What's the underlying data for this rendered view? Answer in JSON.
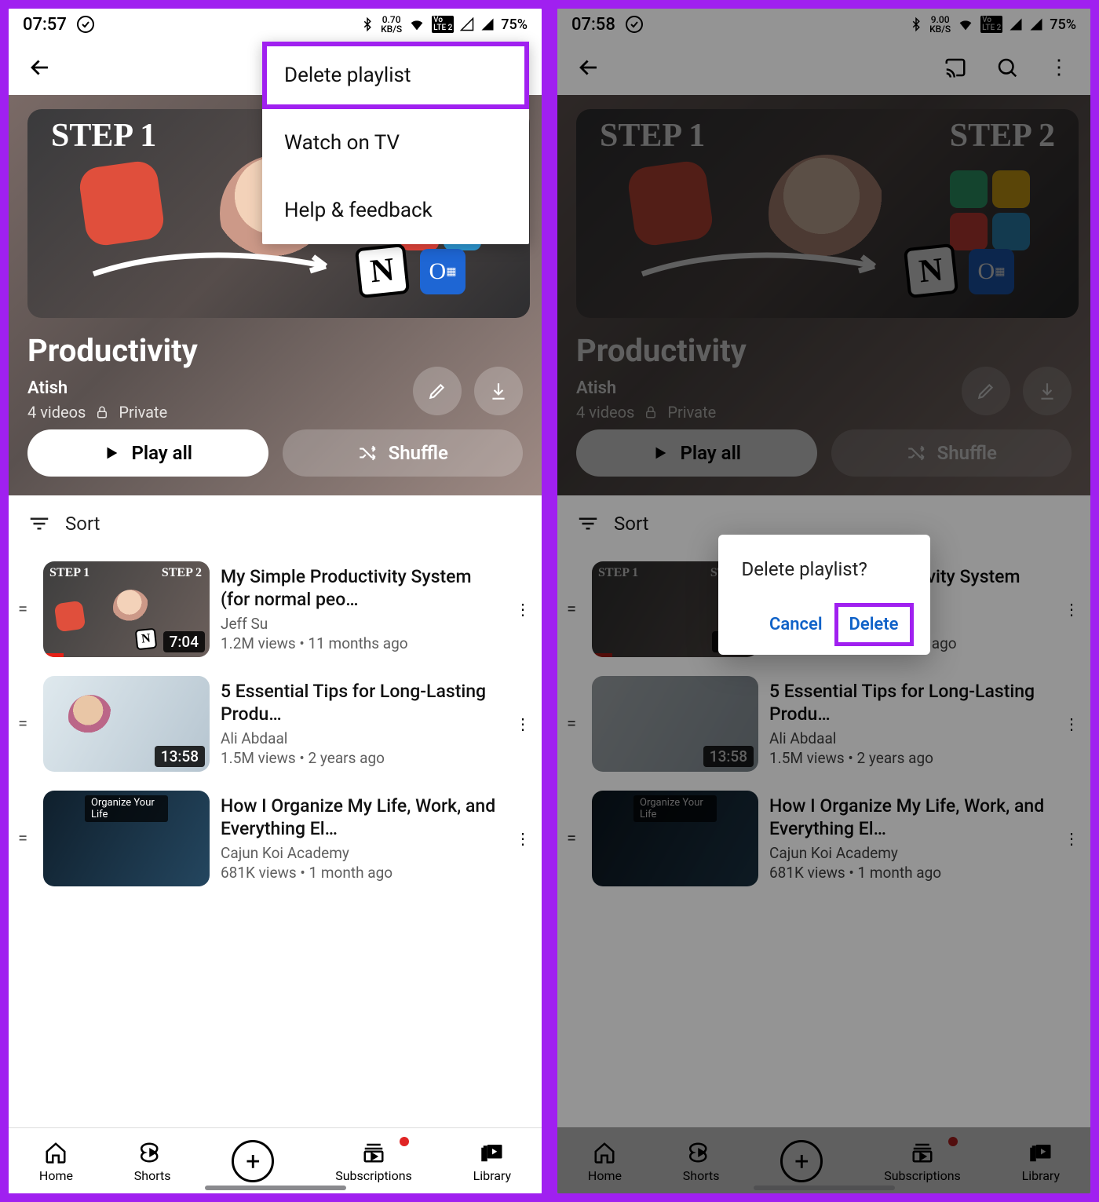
{
  "left": {
    "status": {
      "time": "07:57",
      "net_rate": "0.70",
      "net_unit": "KB/S",
      "lte": "LTE 2",
      "battery": "75%"
    },
    "menu": {
      "items": [
        "Delete playlist",
        "Watch on TV",
        "Help & feedback"
      ],
      "highlighted_index": 0
    }
  },
  "right": {
    "status": {
      "time": "07:58",
      "net_rate": "9.00",
      "net_unit": "KB/S",
      "lte": "LTE 2",
      "battery": "75%"
    },
    "dialog": {
      "title": "Delete playlist?",
      "cancel": "Cancel",
      "confirm": "Delete"
    }
  },
  "playlist": {
    "title": "Productivity",
    "author": "Atish",
    "video_count": "4 videos",
    "privacy": "Private",
    "play_all": "Play all",
    "shuffle": "Shuffle",
    "hero_step1": "STEP 1",
    "hero_step2": "STEP 2"
  },
  "sort_label": "Sort",
  "videos": [
    {
      "title": "My Simple Productivity System (for normal peo…",
      "channel": "Jeff Su",
      "meta": "1.2M views • 11 months ago",
      "duration": "7:04",
      "overlay": "",
      "step1": "STEP 1",
      "step2": "STEP 2"
    },
    {
      "title": "5 Essential Tips for Long-Lasting Produ…",
      "channel": "Ali Abdaal",
      "meta": "1.5M views • 2 years ago",
      "duration": "13:58",
      "overlay": ""
    },
    {
      "title": "How I Organize My Life, Work, and Everything El…",
      "channel": "Cajun Koi Academy",
      "meta": "681K views • 1 month ago",
      "duration": "",
      "overlay": "Organize Your Life"
    }
  ],
  "nav": {
    "home": "Home",
    "shorts": "Shorts",
    "subs": "Subscriptions",
    "library": "Library"
  }
}
